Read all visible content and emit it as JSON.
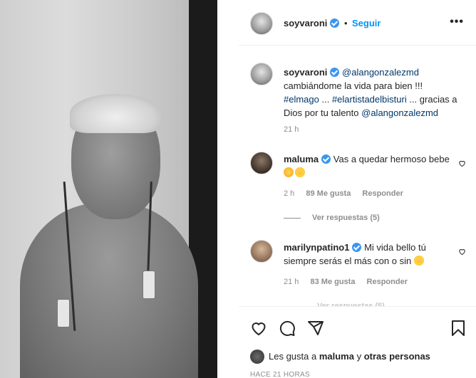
{
  "post": {
    "username": "soyvaroni",
    "follow_label": "Seguir",
    "separator": "•",
    "more_label": "•••"
  },
  "caption": {
    "username": "soyvaroni",
    "mention1": "@alangonzalezmd",
    "text1": "cambiándome la vida para bien !!!",
    "hashtag1": "#elmago",
    "ellipsis1": " ... ",
    "hashtag2": "#elartistadelbisturi",
    "text2": " ... gracias a Dios por tu talento ",
    "mention2": "@alangonzalezmd",
    "time": "21 h"
  },
  "comments": [
    {
      "username": "maluma",
      "text": "Vas a quedar hermoso bebe",
      "time": "2 h",
      "likes": "89 Me gusta",
      "reply_label": "Responder",
      "view_replies": "Ver respuestas (5)"
    },
    {
      "username": "marilynpatino1",
      "text": "Mi vida bello tú siempre serás el más con o sin",
      "time": "21 h",
      "likes": "83 Me gusta",
      "reply_label": "Responder",
      "view_replies": "Ver respuestas (5)"
    }
  ],
  "footer": {
    "likes_prefix": "Les gusta a ",
    "likes_user": "maluma",
    "likes_mid": " y ",
    "likes_others": "otras personas",
    "posted_ago": "HACE 21 HORAS"
  },
  "icons": {
    "like": "heart-icon",
    "comment": "comment-icon",
    "share": "share-icon",
    "save": "bookmark-icon",
    "more": "more-options-icon",
    "verified": "verified-icon"
  },
  "colors": {
    "link_blue": "#0095f6",
    "tag_blue": "#00376b",
    "verified_blue": "#3897f0",
    "muted": "#8e8e8e"
  }
}
